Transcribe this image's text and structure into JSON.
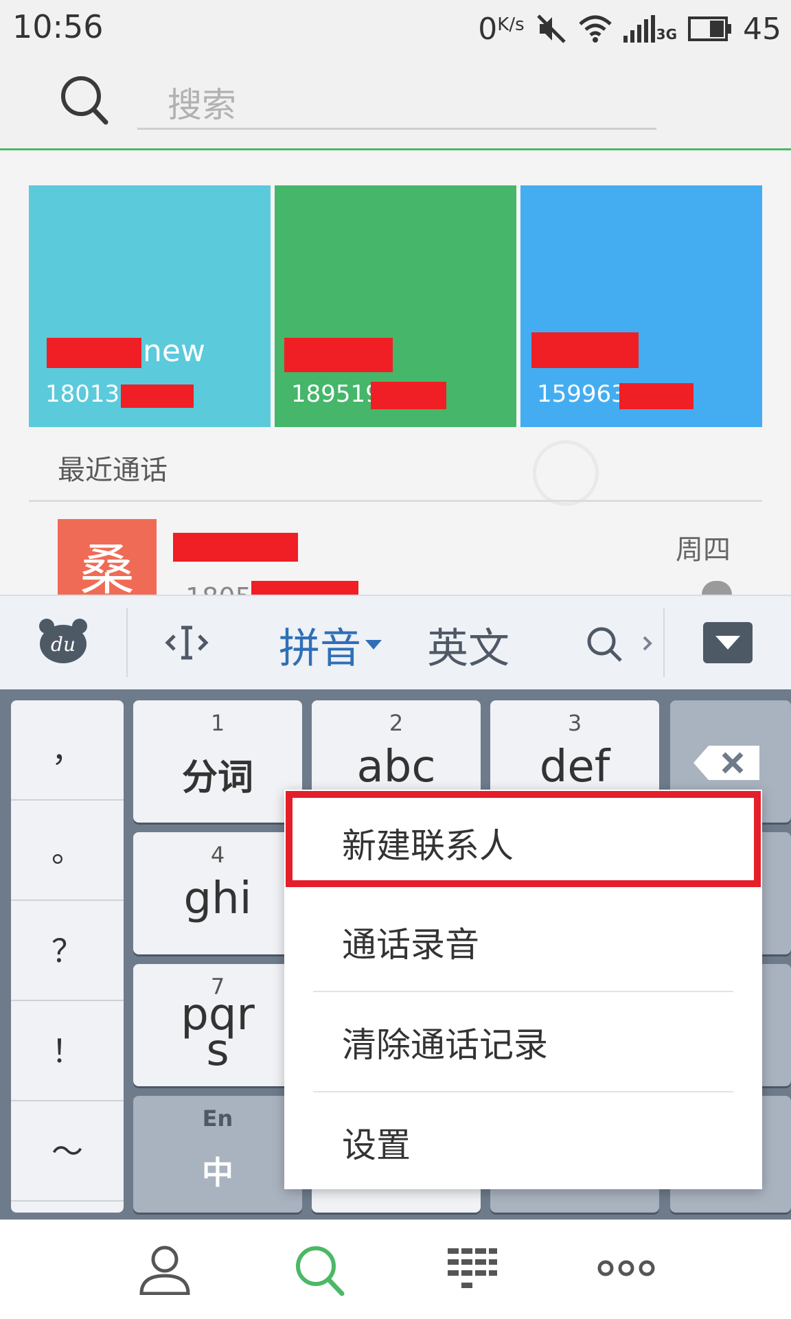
{
  "status_bar": {
    "time": "10:56",
    "network_speed": "0",
    "network_unit": "K/s",
    "network_type": "3G",
    "battery": "45",
    "icons": [
      "mute-icon",
      "wifi-icon",
      "signal-icon",
      "battery-icon"
    ]
  },
  "search": {
    "placeholder": "搜索"
  },
  "favorites": [
    {
      "name_suffix": "new",
      "phone_prefix": "180133",
      "color": "#5bcadb"
    },
    {
      "name_suffix": "",
      "phone_prefix": "189519",
      "color": "#45b66a"
    },
    {
      "name_suffix": "",
      "phone_prefix": "159963",
      "color": "#44adf1"
    }
  ],
  "recent": {
    "label": "最近通话",
    "entries": [
      {
        "avatar_char": "桑",
        "phone_prefix": "1805",
        "day": "周四",
        "avatar_color": "#ef6b55"
      }
    ]
  },
  "keyboard": {
    "mode_pinyin": "拼音",
    "mode_english": "英文",
    "punctuation": [
      "，",
      "。",
      "？",
      "！",
      "～"
    ],
    "keys": [
      {
        "num": "1",
        "label": "分词"
      },
      {
        "num": "2",
        "label": "abc"
      },
      {
        "num": "3",
        "label": "def"
      },
      {
        "num": "4",
        "label": "ghi"
      },
      {
        "num": "7",
        "label": "pqrs"
      }
    ],
    "lang_switch_top": "En",
    "lang_switch_bottom": "中"
  },
  "menu": {
    "items": [
      "新建联系人",
      "通话录音",
      "清除通话记录",
      "设置"
    ],
    "highlight_color": "#e41f2a"
  },
  "bottom_nav": {
    "tabs": [
      "contacts-icon",
      "search-icon",
      "dialpad-icon",
      "more-icon"
    ],
    "active_color": "#4cb865"
  }
}
